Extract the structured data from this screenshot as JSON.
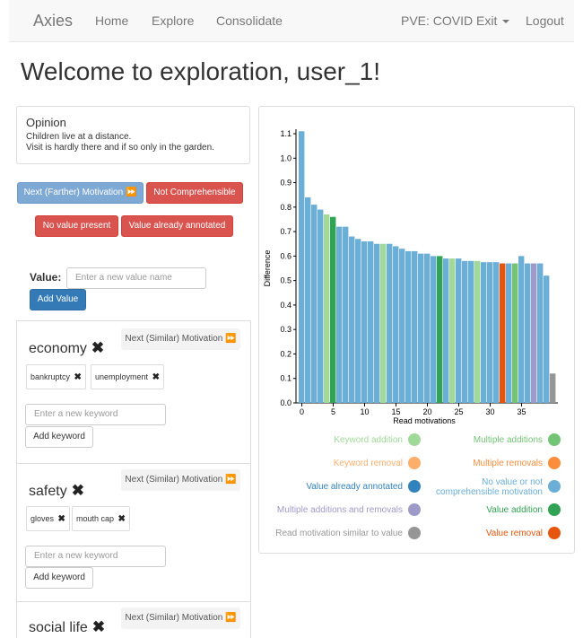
{
  "nav": {
    "brand": "Axies",
    "home": "Home",
    "explore": "Explore",
    "consolidate": "Consolidate",
    "project": "PVE: COVID Exit",
    "logout": "Logout"
  },
  "welcome": "Welcome to exploration, user_1!",
  "opinion": {
    "title": "Opinion",
    "line1": "Children live at a distance.",
    "line2": "Visit is hardly there and if so only in the garden."
  },
  "actions": {
    "next_farther": "Next (Farther) Motivation ⏩",
    "not_comprehensible": "Not Comprehensible",
    "no_value": "No value present",
    "already_annotated": "Value already annotated"
  },
  "value_form": {
    "label": "Value:",
    "placeholder": "Enter a new value name",
    "add_button": "Add Value"
  },
  "values": [
    {
      "name": "economy",
      "next_similar": "Next (Similar) Motivation ⏩",
      "keywords": [
        "bankruptcy",
        "unemployment"
      ],
      "keyword_placeholder": "Enter a new keyword",
      "add_keyword": "Add keyword"
    },
    {
      "name": "safety",
      "next_similar": "Next (Similar) Motivation ⏩",
      "keywords": [
        "gloves",
        "mouth cap"
      ],
      "keyword_placeholder": "Enter a new keyword",
      "add_keyword": "Add keyword"
    },
    {
      "name": "social life",
      "next_similar": "Next (Similar) Motivation ⏩",
      "keywords": [],
      "keyword_placeholder": "",
      "add_keyword": ""
    }
  ],
  "chart_data": {
    "type": "bar",
    "xlabel": "Read motivations",
    "ylabel": "Difference",
    "ylim": [
      0,
      1.1
    ],
    "xticks": [
      0,
      5,
      10,
      15,
      20,
      25,
      30,
      35
    ],
    "yticks": [
      "0.0",
      "0.1",
      "0.2",
      "0.3",
      "0.4",
      "0.5",
      "0.6",
      "0.7",
      "0.8",
      "0.9",
      "1.0",
      "1.1"
    ],
    "values": [
      1.11,
      0.84,
      0.81,
      0.79,
      0.77,
      0.76,
      0.72,
      0.72,
      0.68,
      0.67,
      0.66,
      0.66,
      0.65,
      0.65,
      0.65,
      0.64,
      0.63,
      0.62,
      0.62,
      0.61,
      0.61,
      0.6,
      0.6,
      0.59,
      0.59,
      0.59,
      0.58,
      0.58,
      0.58,
      0.575,
      0.575,
      0.575,
      0.57,
      0.57,
      0.57,
      0.6,
      0.57,
      0.57,
      0.57,
      0.52,
      0.12
    ],
    "categories": [
      "none",
      "none",
      "none",
      "none",
      "kw_add",
      "value_add",
      "none",
      "none",
      "none",
      "none",
      "none",
      "none",
      "none",
      "kw_add",
      "none",
      "none",
      "none",
      "none",
      "none",
      "none",
      "none",
      "none",
      "value_add",
      "none",
      "kw_add",
      "none",
      "none",
      "none",
      "kw_add",
      "none",
      "none",
      "none",
      "value_removal",
      "none",
      "multi_add",
      "none",
      "none",
      "multi_add_rem",
      "none",
      "none",
      "similar"
    ],
    "legend": [
      {
        "key": "kw_add",
        "label": "Keyword addition",
        "color": "#a1d99b",
        "side": "left"
      },
      {
        "key": "multi_add",
        "label": "Multiple additions",
        "color": "#74c476",
        "side": "right"
      },
      {
        "key": "kw_removal",
        "label": "Keyword removal",
        "color": "#fdae6b",
        "side": "left"
      },
      {
        "key": "multi_removal",
        "label": "Multiple removals",
        "color": "#fd8d3c",
        "side": "right"
      },
      {
        "key": "annotated",
        "label": "Value already annotated",
        "color": "#3182bd",
        "side": "left"
      },
      {
        "key": "none",
        "label": "No value or not comprehensible motivation",
        "color": "#6baed6",
        "side": "right"
      },
      {
        "key": "multi_add_rem",
        "label": "Multiple additions and removals",
        "color": "#9e9ac8",
        "side": "left"
      },
      {
        "key": "value_add",
        "label": "Value addition",
        "color": "#31a354",
        "side": "right"
      },
      {
        "key": "similar",
        "label": "Read motivation similar to value",
        "color": "#969696",
        "side": "left"
      },
      {
        "key": "value_removal",
        "label": "Value removal",
        "color": "#e6550d",
        "side": "right"
      }
    ]
  }
}
